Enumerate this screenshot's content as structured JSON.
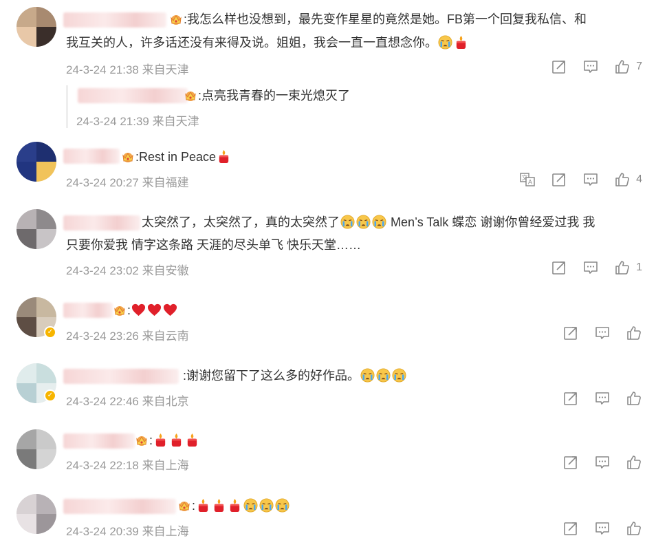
{
  "comments": [
    {
      "text_line1": ":我怎么样也没想到，最先变作星星的竟然是她。FB第一个回复我私信、和",
      "text_line2": "我互关的人，许多话还没有来得及说。姐姐，我会一直一直想念你。",
      "time": "24-3-24 21:38 来自天津",
      "likes": "7",
      "reply": {
        "text": ":点亮我青春的一束光熄灭了",
        "time": "24-3-24 21:39 来自天津"
      }
    },
    {
      "text": ":Rest in Peace",
      "time": "24-3-24 20:27 来自福建",
      "likes": "4"
    },
    {
      "text_line1a": "太突然了，太突然了，真的太突然了",
      "text_line1b": " Men’s Talk 蝶恋 谢谢你曾经爱过我 我",
      "text_line2": "只要你爱我 情字这条路 天涯的尽头单飞 快乐天堂……",
      "time": "24-3-24 23:02 来自安徽",
      "likes": "1"
    },
    {
      "text": ":",
      "time": "24-3-24 23:26 来自云南"
    },
    {
      "text": ":谢谢您留下了这么多的好作品。",
      "time": "24-3-24 22:46 来自北京"
    },
    {
      "text": ":",
      "time": "24-3-24 22:18 来自上海"
    },
    {
      "text": ":",
      "time": "24-3-24 20:39 来自上海"
    }
  ],
  "icons": {
    "share": "share-icon",
    "comment": "comment-icon",
    "like": "thumbs-up-icon",
    "translate": "translate-icon",
    "crown": "crown-badge-icon",
    "candle": "candle-emoji",
    "cry": "crying-emoji",
    "heart": "heart-emoji"
  },
  "colors": {
    "meta_text": "#9a9a9a",
    "body_text": "#333333",
    "icon": "#8a8a8a",
    "heart": "#e0202a",
    "candle": "#e0202a"
  }
}
